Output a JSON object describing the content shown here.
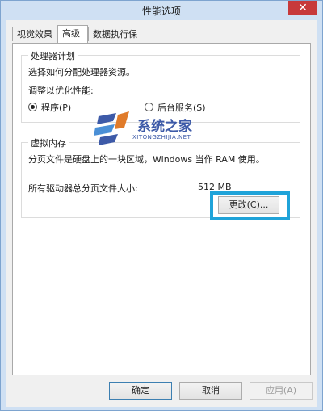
{
  "window": {
    "title": "性能选项",
    "close_glyph": "✕"
  },
  "tabs": [
    {
      "label": "视觉效果",
      "active": false
    },
    {
      "label": "高级",
      "active": true
    },
    {
      "label": "数据执行保护",
      "active": false
    }
  ],
  "processor": {
    "group_title": "处理器计划",
    "description": "选择如何分配处理器资源。",
    "optimize_label": "调整以优化性能:",
    "options": [
      {
        "label": "程序(P)",
        "checked": true
      },
      {
        "label": "后台服务(S)",
        "checked": false
      }
    ]
  },
  "virtual_memory": {
    "group_title": "虚拟内存",
    "description": "分页文件是硬盘上的一块区域，Windows 当作 RAM 使用。",
    "total_label": "所有驱动器总分页文件大小:",
    "total_value": "512 MB",
    "change_button": "更改(C)..."
  },
  "footer": {
    "ok": "确定",
    "cancel": "取消",
    "apply": "应用(A)"
  },
  "watermark": {
    "name": "系统之家",
    "url": "XITONGZHIJIA.NET"
  },
  "colors": {
    "highlight": "#1fa3d9",
    "title_bar": "#cfe0f3",
    "close_button": "#c7393a"
  }
}
